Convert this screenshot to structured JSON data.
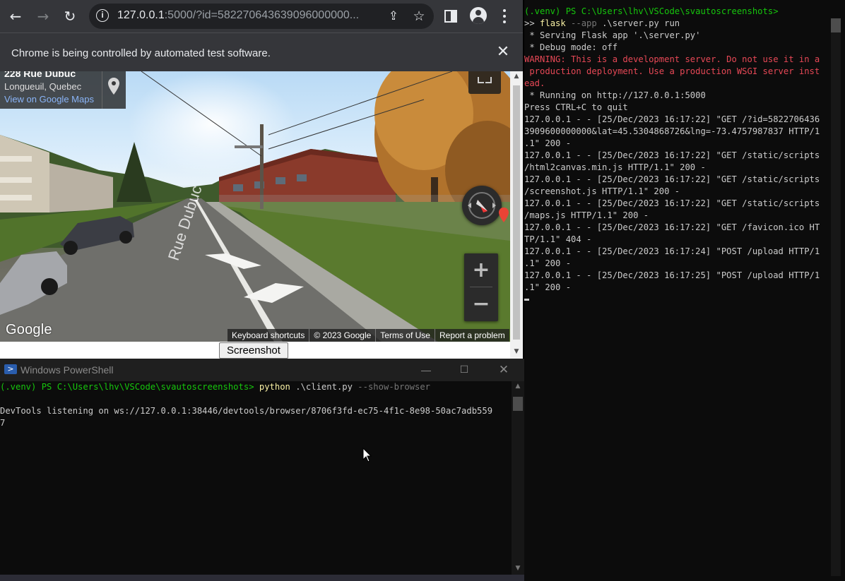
{
  "chrome": {
    "url_host": "127.0.0.1",
    "url_rest": ":5000/?id=582270643639096000000...",
    "infobar_text": "Chrome is being controlled by automated test software.",
    "streetview": {
      "address_title": "228 Rue Dubuc",
      "address_city": "Longueuil, Quebec",
      "maps_link": "View on Google Maps",
      "google_logo": "Google",
      "attribution": [
        "Keyboard shortcuts",
        "© 2023 Google",
        "Terms of Use",
        "Report a problem"
      ],
      "zoom_in": "+",
      "zoom_out": "−",
      "street_label": "Rue Dubuc"
    },
    "screenshot_button": "Screenshot"
  },
  "powershell": {
    "title": "Windows PowerShell",
    "lines": [
      [
        {
          "t": "(.venv) PS C:\\Users\\lhv\\VSCode\\svautoscreenshots> ",
          "c": "c-green"
        },
        {
          "t": "python",
          "c": "c-yellow"
        },
        {
          "t": " .\\client.py ",
          "c": ""
        },
        {
          "t": "--show-browser",
          "c": "c-gray"
        }
      ],
      [
        {
          "t": "",
          "c": ""
        }
      ],
      [
        {
          "t": "DevTools listening on ws://127.0.0.1:38446/devtools/browser/8706f3fd-ec75-4f1c-8e98-50ac7adb559",
          "c": ""
        }
      ],
      [
        {
          "t": "7",
          "c": ""
        }
      ]
    ]
  },
  "server": {
    "lines": [
      [
        {
          "t": "(.venv) PS C:\\Users\\lhv\\VSCode\\svautoscreenshots>",
          "c": "c-green"
        }
      ],
      [
        {
          "t": ">> ",
          "c": ""
        },
        {
          "t": "flask",
          "c": "c-yellow"
        },
        {
          "t": " --app",
          "c": "c-gray"
        },
        {
          "t": " .\\server.py run",
          "c": ""
        }
      ],
      [
        {
          "t": " * Serving Flask app '.\\server.py'",
          "c": ""
        }
      ],
      [
        {
          "t": " * Debug mode: off",
          "c": ""
        }
      ],
      [
        {
          "t": "WARNING: This is a development server. Do not use it in a",
          "c": "c-red"
        }
      ],
      [
        {
          "t": " production deployment. Use a production WSGI server inst",
          "c": "c-red"
        }
      ],
      [
        {
          "t": "ead.",
          "c": "c-red"
        }
      ],
      [
        {
          "t": " * Running on http://127.0.0.1:5000",
          "c": ""
        }
      ],
      [
        {
          "t": "Press CTRL+C to quit",
          "c": ""
        }
      ],
      [
        {
          "t": "127.0.0.1 - - [25/Dec/2023 16:17:22] \"GET /?id=5822706436",
          "c": ""
        }
      ],
      [
        {
          "t": "3909600000000&lat=45.5304868726&lng=-73.4757987837 HTTP/1",
          "c": ""
        }
      ],
      [
        {
          "t": ".1\" 200 -",
          "c": ""
        }
      ],
      [
        {
          "t": "127.0.0.1 - - [25/Dec/2023 16:17:22] \"GET /static/scripts",
          "c": ""
        }
      ],
      [
        {
          "t": "/html2canvas.min.js HTTP/1.1\" 200 -",
          "c": ""
        }
      ],
      [
        {
          "t": "127.0.0.1 - - [25/Dec/2023 16:17:22] \"GET /static/scripts",
          "c": ""
        }
      ],
      [
        {
          "t": "/screenshot.js HTTP/1.1\" 200 -",
          "c": ""
        }
      ],
      [
        {
          "t": "127.0.0.1 - - [25/Dec/2023 16:17:22] \"GET /static/scripts",
          "c": ""
        }
      ],
      [
        {
          "t": "/maps.js HTTP/1.1\" 200 -",
          "c": ""
        }
      ],
      [
        {
          "t": "127.0.0.1 - - [25/Dec/2023 16:17:22] \"GET /favicon.ico HT",
          "c": ""
        }
      ],
      [
        {
          "t": "TP/1.1\" 404 -",
          "c": ""
        }
      ],
      [
        {
          "t": "127.0.0.1 - - [25/Dec/2023 16:17:24] \"POST /upload HTTP/1",
          "c": ""
        }
      ],
      [
        {
          "t": ".1\" 200 -",
          "c": ""
        }
      ],
      [
        {
          "t": "127.0.0.1 - - [25/Dec/2023 16:17:25] \"POST /upload HTTP/1",
          "c": ""
        }
      ],
      [
        {
          "t": ".1\" 200 -",
          "c": ""
        }
      ]
    ]
  }
}
